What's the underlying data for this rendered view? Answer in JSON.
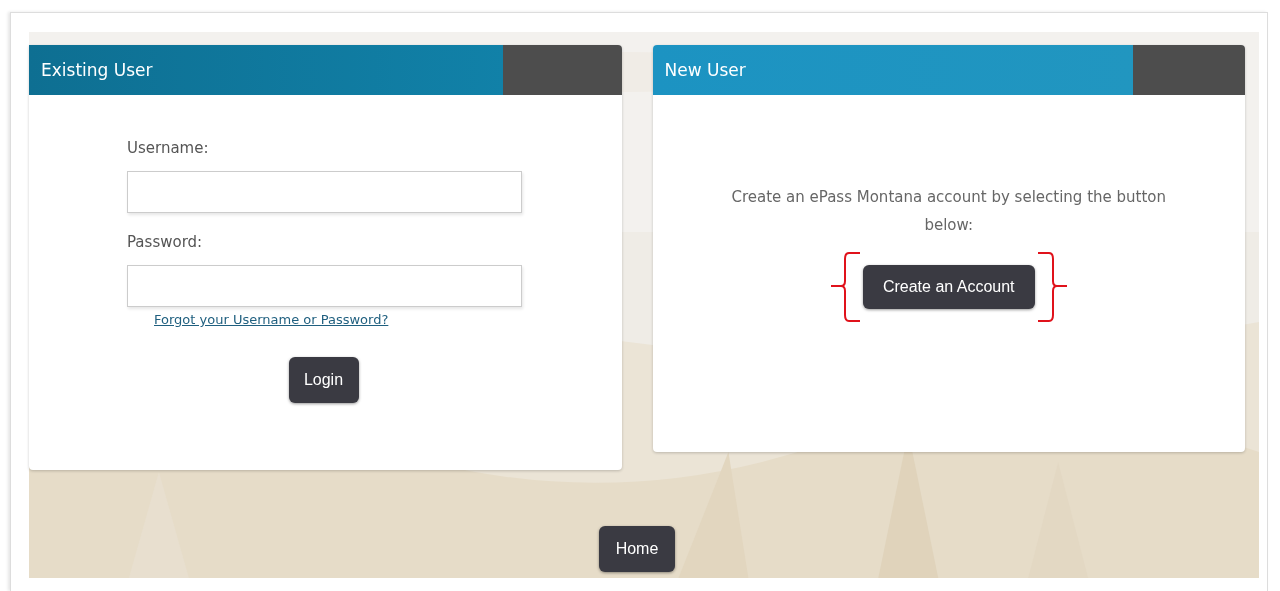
{
  "existing_user": {
    "title": "Existing User",
    "username_label": "Username:",
    "password_label": "Password:",
    "forgot_link": "Forgot your Username or Password?",
    "login_button": "Login"
  },
  "new_user": {
    "title": "New User",
    "text": "Create an ePass Montana account by selecting the button below:",
    "button": "Create an Account"
  },
  "home_button": "Home"
}
